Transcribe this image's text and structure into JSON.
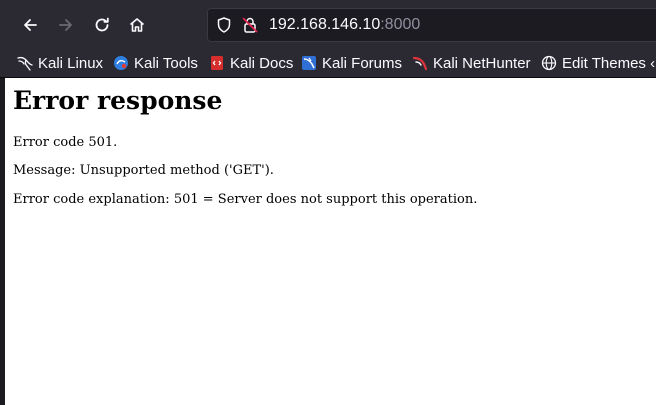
{
  "toolbar": {
    "back_icon": "arrow-left-icon",
    "forward_icon": "arrow-right-icon",
    "reload_icon": "reload-icon",
    "home_icon": "home-icon",
    "url_host": "192.168.146.10",
    "url_port": ":8000"
  },
  "bookmarks": [
    {
      "label": "Kali Linux",
      "icon": "kali-dragon-icon"
    },
    {
      "label": "Kali Tools",
      "icon": "kali-tools-icon"
    },
    {
      "label": "Kali Docs",
      "icon": "kali-docs-icon"
    },
    {
      "label": "Kali Forums",
      "icon": "kali-forums-icon"
    },
    {
      "label": "Kali NetHunter",
      "icon": "kali-nethunter-icon"
    },
    {
      "label": "Edit Themes ‹ S",
      "icon": "globe-icon"
    }
  ],
  "page": {
    "heading": "Error response",
    "error_code": "Error code 501.",
    "message": "Message: Unsupported method ('GET').",
    "explanation": "Error code explanation: 501 = Server does not support this operation."
  },
  "colors": {
    "toolbar_bg": "#2b2a33",
    "urlbar_bg": "#1c1b22",
    "text_light": "#fbfbfe",
    "port_gray": "#8f8f9d",
    "page_bg": "#ffffff"
  }
}
